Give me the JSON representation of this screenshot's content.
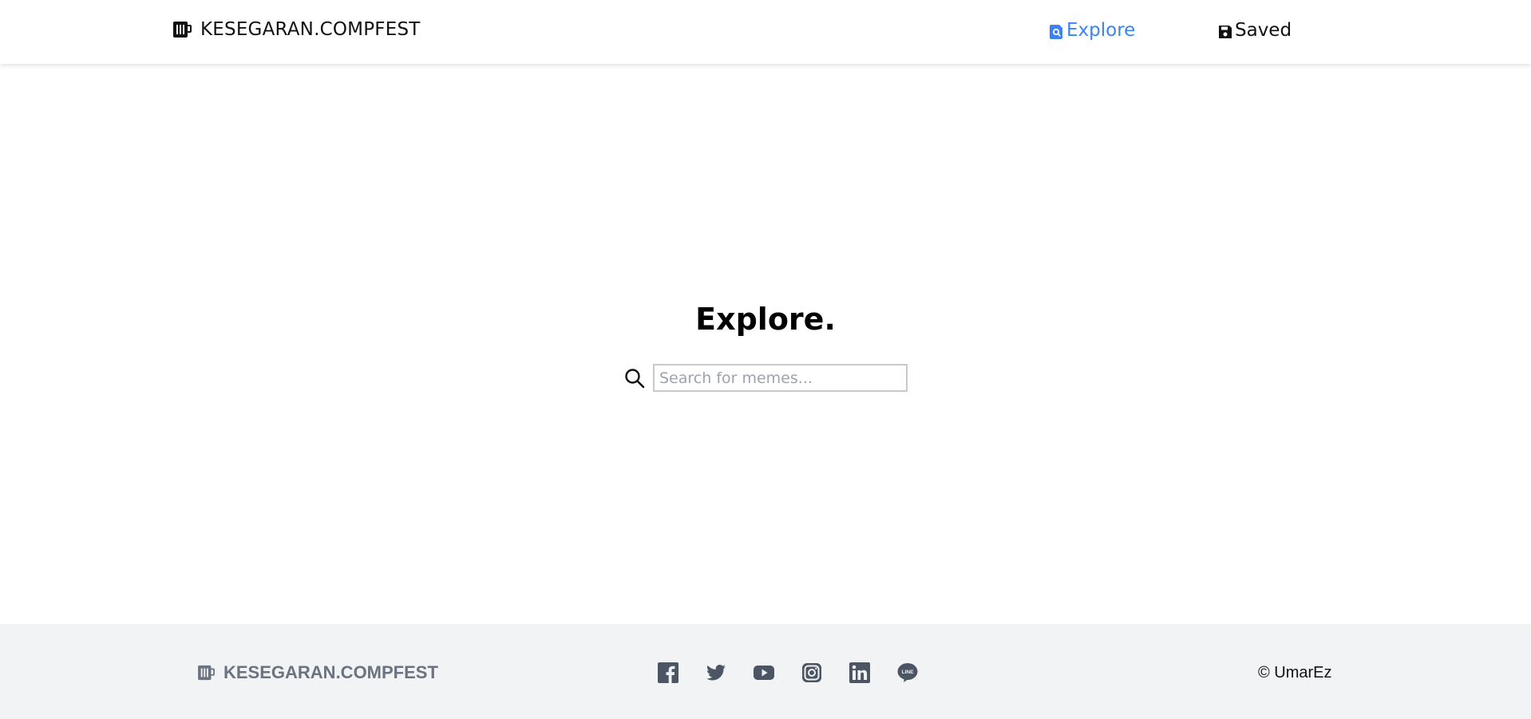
{
  "header": {
    "brand": "KESEGARAN.COMPFEST",
    "brand_icon": "beer-mug-icon",
    "nav": {
      "explore_label": "Explore",
      "explore_icon": "search-file-icon",
      "saved_label": "Saved",
      "saved_icon": "floppy-disk-icon"
    }
  },
  "main": {
    "title": "Explore.",
    "search": {
      "icon": "search-icon",
      "placeholder": "Search for memes...",
      "value": ""
    }
  },
  "footer": {
    "brand": "KESEGARAN.COMPFEST",
    "brand_icon": "beer-mug-icon",
    "socials": [
      "facebook-icon",
      "twitter-icon",
      "youtube-icon",
      "instagram-icon",
      "linkedin-icon",
      "line-icon"
    ],
    "copyright": "© UmarEz"
  },
  "colors": {
    "accent": "#3b82f6",
    "footer_bg": "#f2f3f5",
    "footer_text": "#6b7280",
    "social_icon": "#4b5563"
  }
}
